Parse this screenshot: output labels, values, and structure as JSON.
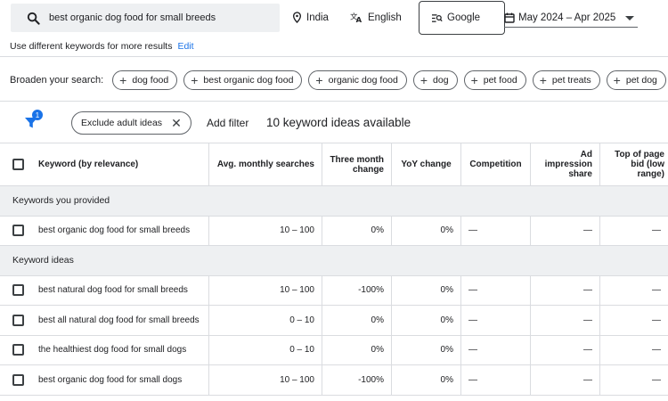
{
  "search": {
    "value": "best organic dog food for small breeds"
  },
  "location": "India",
  "language": "English",
  "network": "Google",
  "date_range": "May 2024 – Apr 2025",
  "hint": {
    "text": "Use different keywords for more results",
    "edit": "Edit"
  },
  "broaden": {
    "label": "Broaden your search:",
    "chips": [
      "dog food",
      "best organic dog food",
      "organic dog food",
      "dog",
      "pet food",
      "pet treats",
      "pet dog"
    ]
  },
  "filters": {
    "badge": "1",
    "exclude_chip": "Exclude adult ideas",
    "add_filter": "Add filter",
    "count_text": "10 keyword ideas available"
  },
  "table": {
    "headers": {
      "keyword": "Keyword (by relevance)",
      "avg": "Avg. monthly searches",
      "three": "Three month change",
      "yoy": "YoY change",
      "comp": "Competition",
      "ad": "Ad impression share",
      "top": "Top of page bid (low range)"
    },
    "group_provided": "Keywords you provided",
    "group_ideas": "Keyword ideas",
    "provided": [
      {
        "keyword": "best organic dog food for small breeds",
        "avg": "10 – 100",
        "three": "0%",
        "yoy": "0%",
        "comp": "—",
        "ad": "—",
        "top": "—"
      }
    ],
    "ideas": [
      {
        "keyword": "best natural dog food for small breeds",
        "avg": "10 – 100",
        "three": "-100%",
        "yoy": "0%",
        "comp": "—",
        "ad": "—",
        "top": "—"
      },
      {
        "keyword": "best all natural dog food for small breeds",
        "avg": "0 – 10",
        "three": "0%",
        "yoy": "0%",
        "comp": "—",
        "ad": "—",
        "top": "—"
      },
      {
        "keyword": "the healthiest dog food for small dogs",
        "avg": "0 – 10",
        "three": "0%",
        "yoy": "0%",
        "comp": "—",
        "ad": "—",
        "top": "—"
      },
      {
        "keyword": "best organic dog food for small dogs",
        "avg": "10 – 100",
        "three": "-100%",
        "yoy": "0%",
        "comp": "—",
        "ad": "—",
        "top": "—"
      }
    ]
  }
}
